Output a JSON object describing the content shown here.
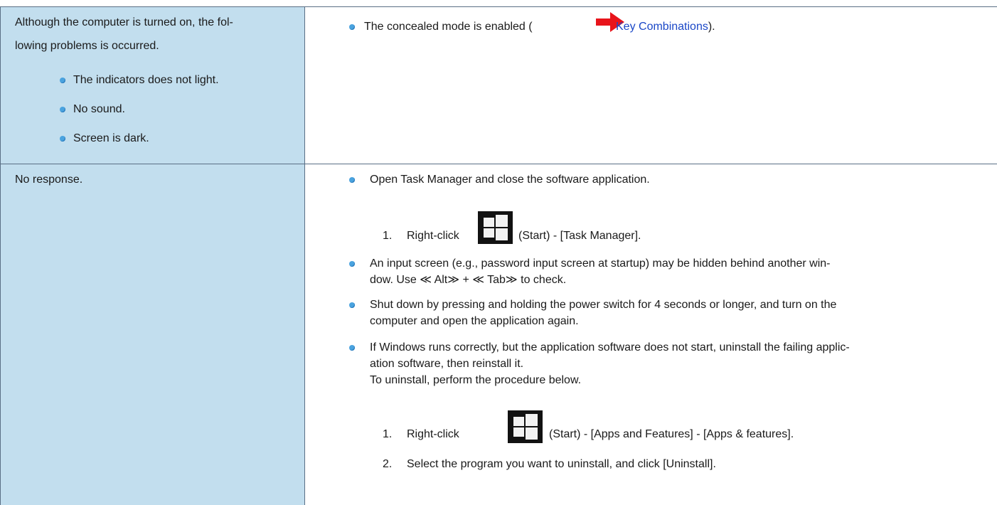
{
  "rows": [
    {
      "symptom": {
        "text_line1": "Although the computer is turned on, the fol-",
        "text_line2": "lowing problems is occurred.",
        "items": [
          "The indicators does not light.",
          "No sound.",
          "Screen is dark."
        ]
      },
      "solution": {
        "bullet_prefix": "The concealed mode is enabled (",
        "link_text": "Key Combinations",
        "bullet_suffix": ")."
      }
    },
    {
      "symptom": {
        "text": "No response."
      },
      "solution": {
        "b1": "Open Task Manager and close the software application.",
        "b1_step_num": "1.",
        "b1_step_pre": "Right-click",
        "b1_step_post": "(Start) - [Task Manager].",
        "b2_line1": "An input screen (e.g., password input screen at startup) may be hidden behind another win-",
        "b2_line2": "dow. Use ≪ Alt≫ + ≪ Tab≫ to check.",
        "b3_line1": "Shut down by pressing and holding the power switch for 4 seconds or longer, and turn on the",
        "b3_line2": "computer and open the application again.",
        "b4_line1": "If Windows runs correctly, but the application software does not start, uninstall the failing applic-",
        "b4_line2": "ation software, then reinstall it.",
        "b4_line3": "To uninstall, perform the procedure below.",
        "s1_num": "1.",
        "s1_pre": "Right-click",
        "s1_post": "(Start) - [Apps and Features] - [Apps & features].",
        "s2_num": "2.",
        "s2_text": "Select the program you want to uninstall, and click [Uninstall]."
      }
    }
  ],
  "icons": {
    "arrow": "red-arrow-icon",
    "start": "windows-start-icon"
  },
  "colors": {
    "symptom_bg": "#c2deee",
    "border": "#5a6f85",
    "link": "#1a47c7",
    "bullet": "#4aa3df",
    "arrow": "#e8141b"
  }
}
